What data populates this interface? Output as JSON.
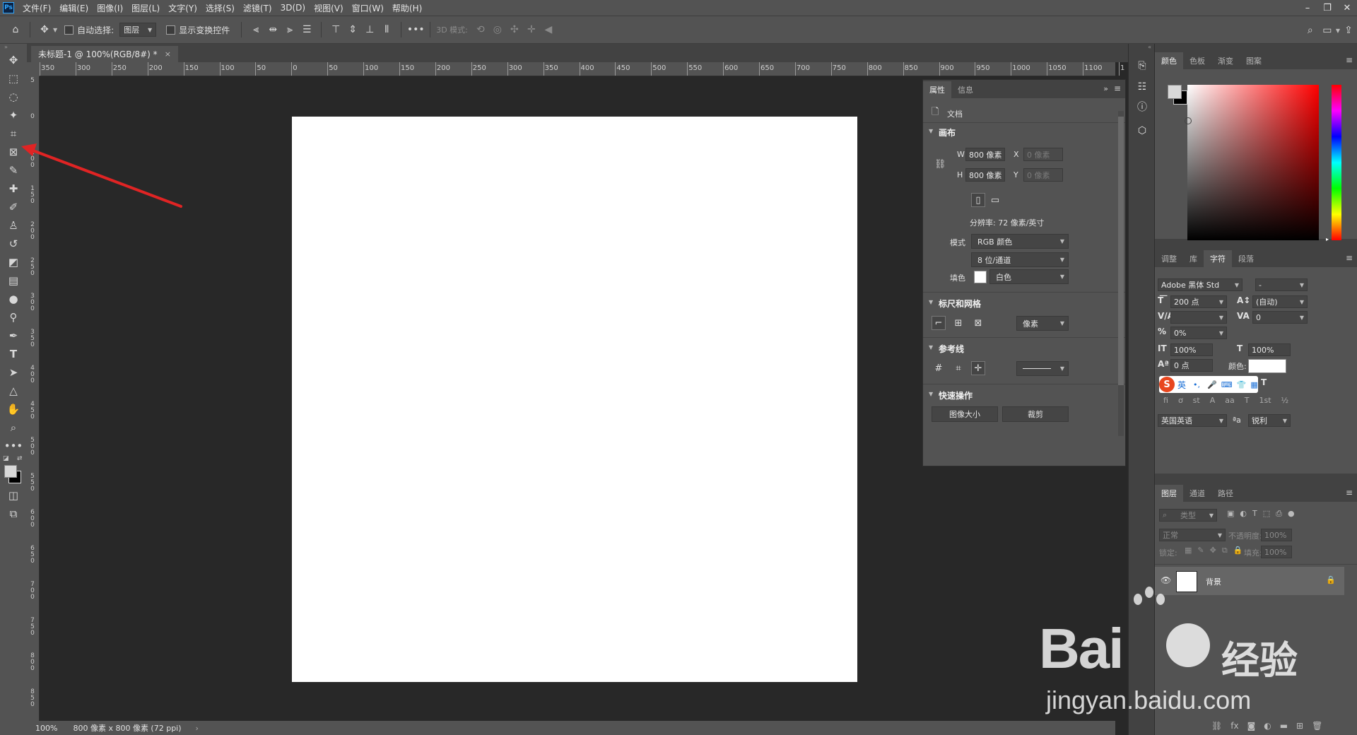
{
  "menubar": {
    "logo": "Ps",
    "items": [
      "文件(F)",
      "编辑(E)",
      "图像(I)",
      "图层(L)",
      "文字(Y)",
      "选择(S)",
      "滤镜(T)",
      "3D(D)",
      "视图(V)",
      "窗口(W)",
      "帮助(H)"
    ]
  },
  "options": {
    "auto_select_label": "自动选择:",
    "auto_select_value": "图层",
    "show_transform_label": "显示变换控件",
    "mode_3d_label": "3D 模式:"
  },
  "document": {
    "tab_title": "未标题-1 @ 100%(RGB/8#) *",
    "close": "×"
  },
  "ruler": {
    "h_labels": [
      "350",
      "300",
      "250",
      "200",
      "150",
      "100",
      "50",
      "0",
      "50",
      "100",
      "150",
      "200",
      "250",
      "300",
      "350",
      "400",
      "450",
      "500",
      "550",
      "600",
      "650",
      "700",
      "750",
      "800",
      "850",
      "900",
      "950",
      "1000",
      "1050",
      "1100",
      "1"
    ],
    "v_labels": [
      "5",
      "0",
      "1\n0\n0",
      "1\n5\n0",
      "2\n0\n0",
      "2\n5\n0",
      "3\n0\n0",
      "3\n5\n0",
      "4\n0\n0",
      "4\n5\n0",
      "5\n0\n0",
      "5\n5\n0",
      "6\n0\n0",
      "6\n5\n0",
      "7\n0\n0",
      "7\n5\n0",
      "8\n0\n0",
      "8\n5\n0"
    ]
  },
  "status": {
    "zoom": "100%",
    "doc_info": "800 像素 x 800 像素 (72 ppi)",
    "arrow": "›"
  },
  "properties": {
    "tabs": [
      "属性",
      "信息"
    ],
    "doc_label": "文档",
    "canvas_title": "画布",
    "w_label": "W",
    "w_value": "800 像素",
    "h_label": "H",
    "h_value": "800 像素",
    "x_label": "X",
    "x_value": "0 像素",
    "y_label": "Y",
    "y_value": "0 像素",
    "resolution": "分辨率: 72 像素/英寸",
    "mode_label": "模式",
    "mode_value": "RGB 颜色",
    "depth_value": "8 位/通道",
    "fill_label": "填色",
    "fill_value": "白色",
    "rulers_title": "标尺和网格",
    "units_value": "像素",
    "guides_title": "参考线",
    "quick_title": "快速操作",
    "btn_image_size": "图像大小",
    "btn_crop": "裁剪"
  },
  "color_panel": {
    "tabs": [
      "颜色",
      "色板",
      "渐变",
      "图案"
    ]
  },
  "char_panel": {
    "tabs": [
      "调整",
      "库",
      "字符",
      "段落"
    ],
    "font_family": "Adobe 黑体 Std",
    "font_style": "-",
    "font_size": "200 点",
    "leading": "(自动)",
    "kerning": "",
    "tracking": "0",
    "scale_pct": "0%",
    "vscale": "100%",
    "hscale": "100%",
    "baseline": "0 点",
    "color_label": "颜色:",
    "ime_label": "英",
    "language": "英国英语",
    "aa_label": "ªa",
    "antialias": "锐利"
  },
  "layers_panel": {
    "tabs": [
      "图层",
      "通道",
      "路径"
    ],
    "filter_placeholder": "类型",
    "blend_mode": "正常",
    "opacity_label": "不透明度:",
    "opacity_value": "100%",
    "lock_label": "锁定:",
    "fill_label": "填充:",
    "fill_value": "100%",
    "layer_name": "背景"
  },
  "watermark": {
    "brand": "Bai",
    "brand2": "经验",
    "url": "jingyan.baidu.com"
  },
  "colors": {
    "arrow": "#e02424",
    "accent": "#31a8ff"
  }
}
